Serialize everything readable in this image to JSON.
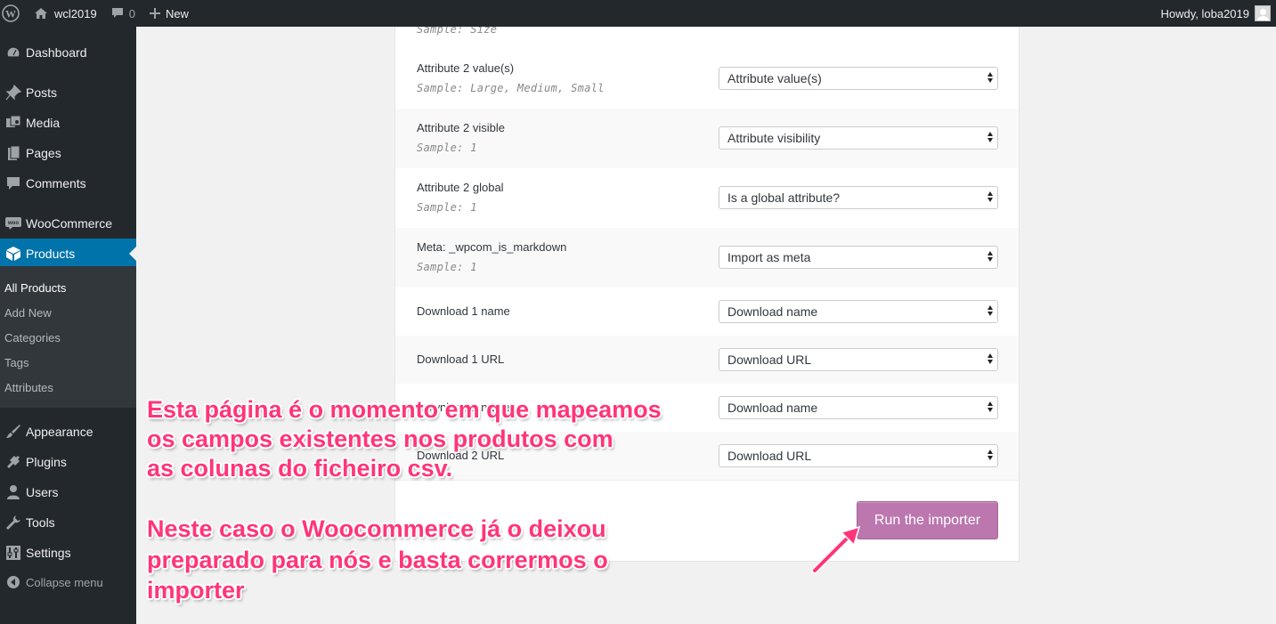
{
  "adminbar": {
    "site_name": "wcl2019",
    "comments_count": "0",
    "new_label": "New",
    "howdy": "Howdy, loba2019"
  },
  "sidebar": {
    "items": [
      {
        "label": "Dashboard",
        "icon": "dashboard-icon"
      },
      {
        "label": "Posts",
        "icon": "pin-icon"
      },
      {
        "label": "Media",
        "icon": "media-icon"
      },
      {
        "label": "Pages",
        "icon": "pages-icon"
      },
      {
        "label": "Comments",
        "icon": "comment-icon"
      },
      {
        "label": "WooCommerce",
        "icon": "woo-icon"
      },
      {
        "label": "Products",
        "icon": "box-icon"
      },
      {
        "label": "Appearance",
        "icon": "brush-icon"
      },
      {
        "label": "Plugins",
        "icon": "plug-icon"
      },
      {
        "label": "Users",
        "icon": "user-icon"
      },
      {
        "label": "Tools",
        "icon": "wrench-icon"
      },
      {
        "label": "Settings",
        "icon": "settings-icon"
      }
    ],
    "submenu": [
      "All Products",
      "Add New",
      "Categories",
      "Tags",
      "Attributes"
    ],
    "collapse": "Collapse menu"
  },
  "mapping": {
    "top_sample": "Sample: Size",
    "rows": [
      {
        "label": "Attribute 2 value(s)",
        "sample": "Sample: Large, Medium, Small",
        "value": "Attribute value(s)"
      },
      {
        "label": "Attribute 2 visible",
        "sample": "Sample: 1",
        "value": "Attribute visibility"
      },
      {
        "label": "Attribute 2 global",
        "sample": "Sample: 1",
        "value": "Is a global attribute?"
      },
      {
        "label": "Meta: _wpcom_is_markdown",
        "sample": "Sample: 1",
        "value": "Import as meta"
      },
      {
        "label": "Download 1 name",
        "sample": "",
        "value": "Download name"
      },
      {
        "label": "Download 1 URL",
        "sample": "",
        "value": "Download URL"
      },
      {
        "label": "Download 2 name",
        "sample": "",
        "value": "Download name"
      },
      {
        "label": "Download 2 URL",
        "sample": "",
        "value": "Download URL"
      }
    ],
    "run_button": "Run the importer"
  },
  "annotation": {
    "para1": [
      "Esta página é o momento em que mapeamos",
      "os campos existentes nos produtos com",
      "as colunas do ficheiro csv."
    ],
    "para2": [
      "Neste caso o Woocommerce já o deixou",
      "preparado para nós e basta corrermos o",
      "importer"
    ]
  },
  "colors": {
    "adminbar": "#23282d",
    "sidebar_current": "#0073aa",
    "button": "#bb77ae",
    "annotation": "#ff3579"
  }
}
